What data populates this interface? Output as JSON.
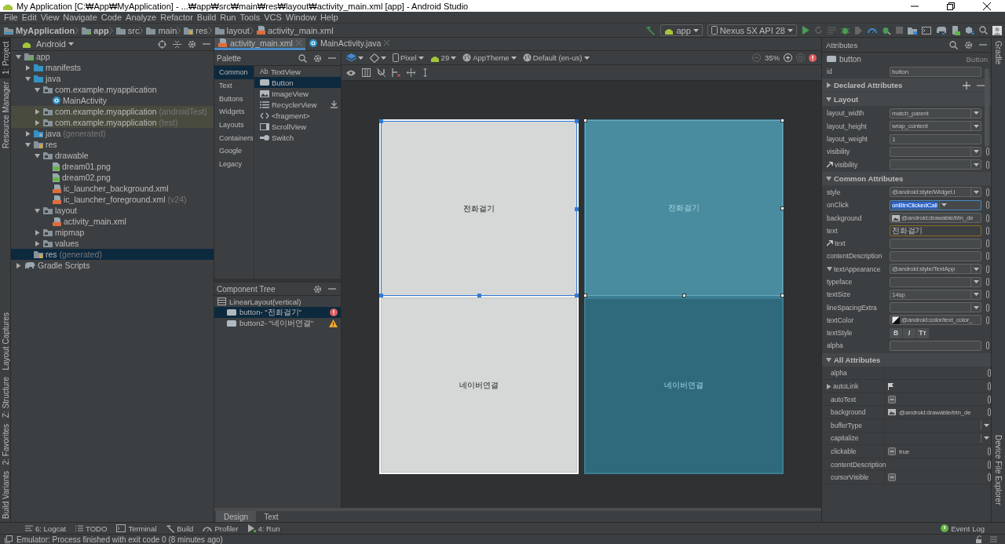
{
  "window": {
    "title": "My Application [C:₩App₩MyApplication] - ...₩app₩src₩main₩res₩layout₩activity_main.xml [app] - Android Studio"
  },
  "menu": [
    "File",
    "Edit",
    "View",
    "Navigate",
    "Code",
    "Analyze",
    "Refactor",
    "Build",
    "Run",
    "Tools",
    "VCS",
    "Window",
    "Help"
  ],
  "breadcrumb": [
    {
      "label": "MyApplication",
      "kind": "project"
    },
    {
      "label": "app",
      "kind": "module"
    },
    {
      "label": "src",
      "kind": "folder"
    },
    {
      "label": "main",
      "kind": "folder"
    },
    {
      "label": "res",
      "kind": "res"
    },
    {
      "label": "layout",
      "kind": "folder"
    },
    {
      "label": "activity_main.xml",
      "kind": "xml"
    }
  ],
  "run_toolbar": {
    "configuration": "app",
    "device": "Nexus 5X API 28"
  },
  "left_tool_windows": [
    {
      "label": "1: Project",
      "selected": true
    },
    {
      "label": "Resource Manager",
      "selected": false
    },
    {
      "label": "Layout Captures",
      "selected": false
    },
    {
      "label": "Z: Structure",
      "selected": false
    },
    {
      "label": "2: Favorites",
      "selected": false
    },
    {
      "label": "Build Variants",
      "selected": false
    }
  ],
  "project": {
    "view": "Android",
    "tree": [
      {
        "label": "app",
        "kind": "module",
        "expanded": true,
        "selected": false,
        "children": [
          {
            "label": "manifests",
            "kind": "folder",
            "expanded": false,
            "selected": false
          },
          {
            "label": "java",
            "kind": "folder",
            "expanded": true,
            "selected": false,
            "children": [
              {
                "label": "com.example.myapplication",
                "kind": "package",
                "expanded": true,
                "selected": false,
                "children": [
                  {
                    "label": "MainActivity",
                    "kind": "class",
                    "selected": false
                  }
                ]
              },
              {
                "label": "com.example.myapplication",
                "suffix": "(androidTest)",
                "kind": "package",
                "expanded": false,
                "selected": false,
                "highlighted": true
              },
              {
                "label": "com.example.myapplication",
                "suffix": "(test)",
                "kind": "package",
                "expanded": false,
                "selected": false,
                "highlighted": true
              }
            ]
          },
          {
            "label": "java",
            "suffix": "(generated)",
            "kind": "generated",
            "expanded": false,
            "selected": false
          },
          {
            "label": "res",
            "kind": "res",
            "expanded": true,
            "selected": false,
            "children": [
              {
                "label": "drawable",
                "kind": "package",
                "expanded": true,
                "selected": false,
                "children": [
                  {
                    "label": "dream01.png",
                    "kind": "image",
                    "selected": false
                  },
                  {
                    "label": "dream02.png",
                    "kind": "image",
                    "selected": false
                  },
                  {
                    "label": "ic_launcher_background.xml",
                    "kind": "xml",
                    "selected": false
                  },
                  {
                    "label": "ic_launcher_foreground.xml",
                    "suffix": "(v24)",
                    "kind": "xml",
                    "selected": false
                  }
                ]
              },
              {
                "label": "layout",
                "kind": "package",
                "expanded": true,
                "selected": false,
                "children": [
                  {
                    "label": "activity_main.xml",
                    "kind": "xml",
                    "selected": false
                  }
                ]
              },
              {
                "label": "mipmap",
                "kind": "package",
                "expanded": false,
                "selected": false
              },
              {
                "label": "values",
                "kind": "package",
                "expanded": false,
                "selected": false
              }
            ]
          },
          {
            "label": "res",
            "suffix": "(generated)",
            "kind": "res",
            "selected": true
          }
        ]
      },
      {
        "label": "Gradle Scripts",
        "kind": "gradle",
        "expanded": false,
        "selected": false
      }
    ]
  },
  "editor_tabs": [
    {
      "label": "activity_main.xml",
      "kind": "xml",
      "selected": true
    },
    {
      "label": "MainActivity.java",
      "kind": "class",
      "selected": false
    }
  ],
  "palette": {
    "title": "Palette",
    "categories": [
      {
        "label": "Common",
        "selected": true
      },
      {
        "label": "Text",
        "selected": false
      },
      {
        "label": "Buttons",
        "selected": false
      },
      {
        "label": "Widgets",
        "selected": false
      },
      {
        "label": "Layouts",
        "selected": false
      },
      {
        "label": "Containers",
        "selected": false
      },
      {
        "label": "Google",
        "selected": false
      },
      {
        "label": "Legacy",
        "selected": false
      }
    ],
    "items": [
      {
        "label": "TextView",
        "kind": "text",
        "icon_text": "Ab",
        "selected": false
      },
      {
        "label": "Button",
        "kind": "button",
        "selected": true
      },
      {
        "label": "ImageView",
        "kind": "image",
        "selected": false
      },
      {
        "label": "RecyclerView",
        "kind": "list",
        "selected": false,
        "download": true
      },
      {
        "label": "<fragment>",
        "kind": "code",
        "selected": false
      },
      {
        "label": "ScrollView",
        "kind": "scroll",
        "selected": false
      },
      {
        "label": "Switch",
        "kind": "switch",
        "selected": false
      }
    ]
  },
  "component_tree": {
    "title": "Component Tree",
    "items": [
      {
        "label": "LinearLayout(vertical)",
        "kind": "layout",
        "selected": false,
        "children": [
          {
            "label": "button- \"전화걸기\"",
            "kind": "button",
            "selected": true,
            "error": true,
            "warning": false
          },
          {
            "label": "button2- \"네이버연결\"",
            "kind": "button",
            "selected": false,
            "error": false,
            "warning": true
          }
        ]
      }
    ]
  },
  "design_toolbar": {
    "device": "Pixel",
    "api": "29",
    "theme": "AppTheme",
    "locale": "Default (en-us)",
    "zoom": "35%"
  },
  "canvas": {
    "design": [
      {
        "text": "전화걸기",
        "selected": true
      },
      {
        "text": "네이버연결",
        "selected": false
      }
    ],
    "blueprint": [
      {
        "text": "전화걸기",
        "selected": true
      },
      {
        "text": "네이버연결",
        "selected": false
      }
    ]
  },
  "editor_modes": [
    {
      "label": "Design",
      "selected": true
    },
    {
      "label": "Text",
      "selected": false
    }
  ],
  "attributes": {
    "title": "Attributes",
    "component": {
      "name": "button",
      "type": "Button"
    },
    "id": {
      "label": "id",
      "value": "button"
    },
    "sections": [
      {
        "title": "Declared Attributes",
        "expanded": false
      },
      {
        "title": "Layout",
        "kind": "fields",
        "expanded": true,
        "rows": [
          {
            "label": "layout_width",
            "value": "match_parent",
            "kind": "dropdown"
          },
          {
            "label": "layout_height",
            "value": "wrap_content",
            "kind": "dropdown"
          },
          {
            "label": "layout_weight",
            "value": "1",
            "kind": "field"
          },
          {
            "label": "visibility",
            "kind": "dropdown"
          },
          {
            "label": "visibility",
            "kind": "dropdown",
            "tool": true
          }
        ]
      },
      {
        "title": "Common Attributes",
        "kind": "fields",
        "expanded": true,
        "rows": [
          {
            "label": "style",
            "value": "@android:style/Widget.I",
            "kind": "dropdown"
          },
          {
            "label": "onClick",
            "value": "onBtnClickedCall",
            "kind": "dropdown",
            "text_selected": true
          },
          {
            "label": "background",
            "value": "@android:drawable/btn_de",
            "kind": "image"
          },
          {
            "label": "text",
            "value": "전화걸기",
            "kind": "field",
            "editing": true
          },
          {
            "label": "text",
            "kind": "field",
            "tool": true
          },
          {
            "label": "contentDescription",
            "kind": "field"
          },
          {
            "label": "textAppearance",
            "value": "@android:style/TextApp",
            "kind": "dropdown",
            "expanded": true
          },
          {
            "label": "typeface",
            "kind": "dropdown"
          },
          {
            "label": "textSize",
            "value": "14sp",
            "kind": "dropdown"
          },
          {
            "label": "lineSpacingExtra",
            "kind": "dropdown"
          },
          {
            "label": "textColor",
            "value": "@android:color/text_color_",
            "kind": "color"
          },
          {
            "label": "textStyle",
            "kind": "styles",
            "buttons": [
              {
                "label": "B",
                "kind": "bold"
              },
              {
                "label": "I",
                "kind": "italic"
              },
              {
                "label": "Tт",
                "kind": "caps"
              }
            ]
          },
          {
            "label": "alpha",
            "kind": "field"
          }
        ]
      },
      {
        "title": "All Attributes",
        "kind": "table",
        "expanded": true,
        "rows": [
          {
            "label": "alpha",
            "kind": "empty"
          },
          {
            "label": "autoLink",
            "kind": "flag",
            "expanded": false
          },
          {
            "label": "autoText",
            "kind": "tristate"
          },
          {
            "label": "background",
            "value": "@android:drawable/btn_de",
            "kind": "image"
          },
          {
            "label": "bufferType",
            "kind": "dropdown"
          },
          {
            "label": "capitalize",
            "kind": "dropdown"
          },
          {
            "label": "clickable",
            "value": "true",
            "kind": "tristate"
          },
          {
            "label": "contentDescription",
            "kind": "empty"
          },
          {
            "label": "cursorVisible",
            "kind": "tristate"
          }
        ]
      }
    ]
  },
  "right_tool_windows": [
    {
      "label": "Gradle"
    },
    {
      "label": "Device File Explorer"
    }
  ],
  "tool_windows": [
    {
      "label": "6: Logcat",
      "kind": "logcat"
    },
    {
      "label": "TODO",
      "kind": "todo"
    },
    {
      "label": "Terminal",
      "kind": "terminal"
    },
    {
      "label": "Build",
      "kind": "build"
    },
    {
      "label": "Profiler",
      "kind": "profiler"
    },
    {
      "label": "4: Run",
      "kind": "run"
    }
  ],
  "event_log": "Event Log",
  "status_bar": "Emulator: Process finished with exit code 0 (8 minutes ago)"
}
